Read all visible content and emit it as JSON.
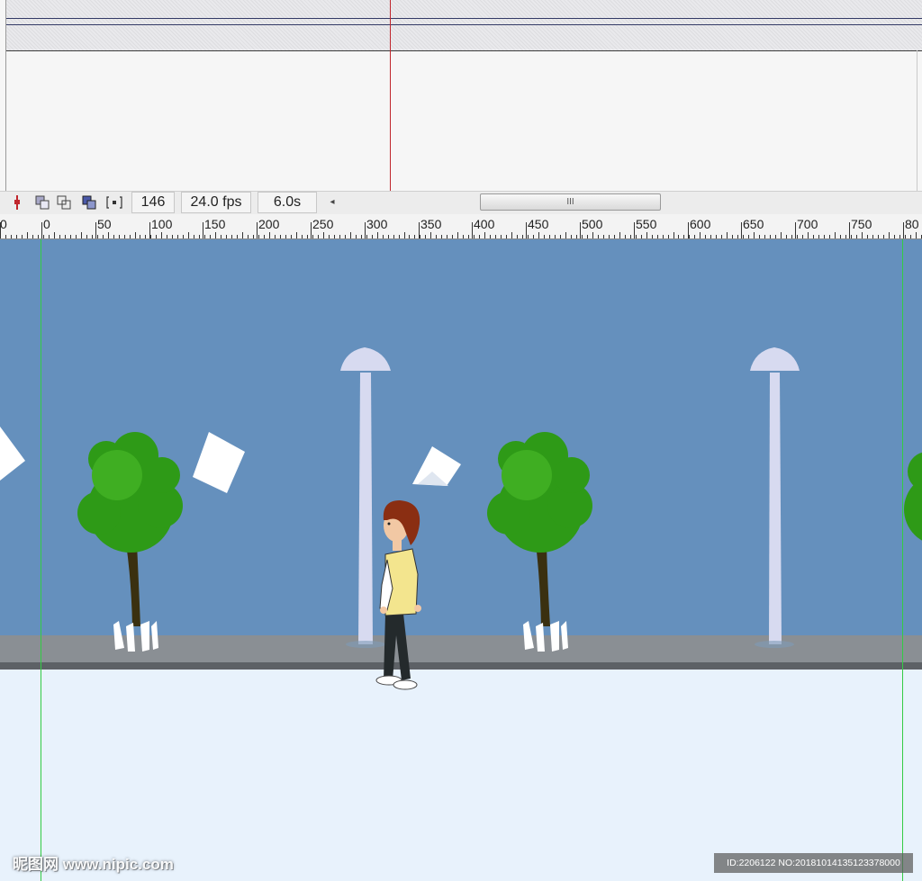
{
  "timeline": {
    "current_frame": "146",
    "frame_rate": "24.0 fps",
    "elapsed_time": "6.0s"
  },
  "toolbar_icons": [
    "center-frame-icon",
    "onion-skin-icon",
    "onion-skin-outlines-icon",
    "edit-multiple-frames-icon",
    "modify-onion-markers-icon"
  ],
  "scrollbar": {
    "thumb_grip": "III",
    "left_arrow": "◂"
  },
  "ruler": {
    "labels": [
      "0",
      "0",
      "50",
      "100",
      "150",
      "200",
      "250",
      "300",
      "350",
      "400",
      "450",
      "500",
      "550",
      "600",
      "650",
      "700",
      "750",
      "80"
    ]
  },
  "stage": {
    "sky_color": "#6590bd",
    "sidewalk_color": "#8a8f94",
    "ground_color": "#e8f2fc",
    "tree_color": "#2e9a17",
    "lamp_color": "#d7daf0",
    "paper_color": "#ffffff"
  },
  "watermarks": {
    "left": "昵图网 www.nipic.com",
    "right": "ID:2206122 NO:20181014135123378000"
  }
}
